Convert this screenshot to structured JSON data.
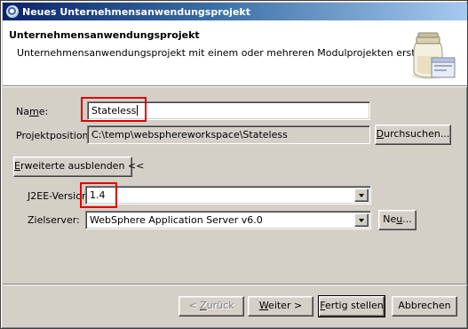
{
  "window": {
    "title": "Neues Unternehmensanwendungsprojekt"
  },
  "banner": {
    "title": "Unternehmensanwendungsprojekt",
    "description": "Unternehmensanwendungsprojekt mit einem oder mehreren Modulprojekten erstellen."
  },
  "form": {
    "name_label_pre": "Na",
    "name_label_mn": "m",
    "name_label_post": "e:",
    "name_value": "Stateless",
    "location_label": "Projektposition:",
    "location_value": "C:\\temp\\websphereworkspace\\Stateless",
    "browse_button": {
      "mnem": "D",
      "rest": "urchsuchen..."
    },
    "advanced_button": {
      "mnem": "E",
      "rest": "rweiterte ausblenden <<"
    },
    "j2ee_label": "J2EE-Version:",
    "j2ee_value": "1.4",
    "server_label": "Zielserver:",
    "server_value": "WebSphere Application Server v6.0",
    "new_button": {
      "pre": "Ne",
      "mnem": "u",
      "rest": "..."
    }
  },
  "footer": {
    "back_button": {
      "pre": "< ",
      "mnem": "Z",
      "rest": "urück"
    },
    "next_button": {
      "mnem": "W",
      "rest": "eiter >"
    },
    "finish_button": {
      "mnem": "F",
      "rest": "ertig stellen"
    },
    "cancel_button": "Abbrechen"
  },
  "colors": {
    "highlight_box": "#e00000",
    "title_bar_start": "#0a246a",
    "title_bar_end": "#a6caf0"
  },
  "icons": [
    "eclipse-app-icon",
    "jar-wizard-graphic",
    "dropdown-arrow-icon"
  ]
}
